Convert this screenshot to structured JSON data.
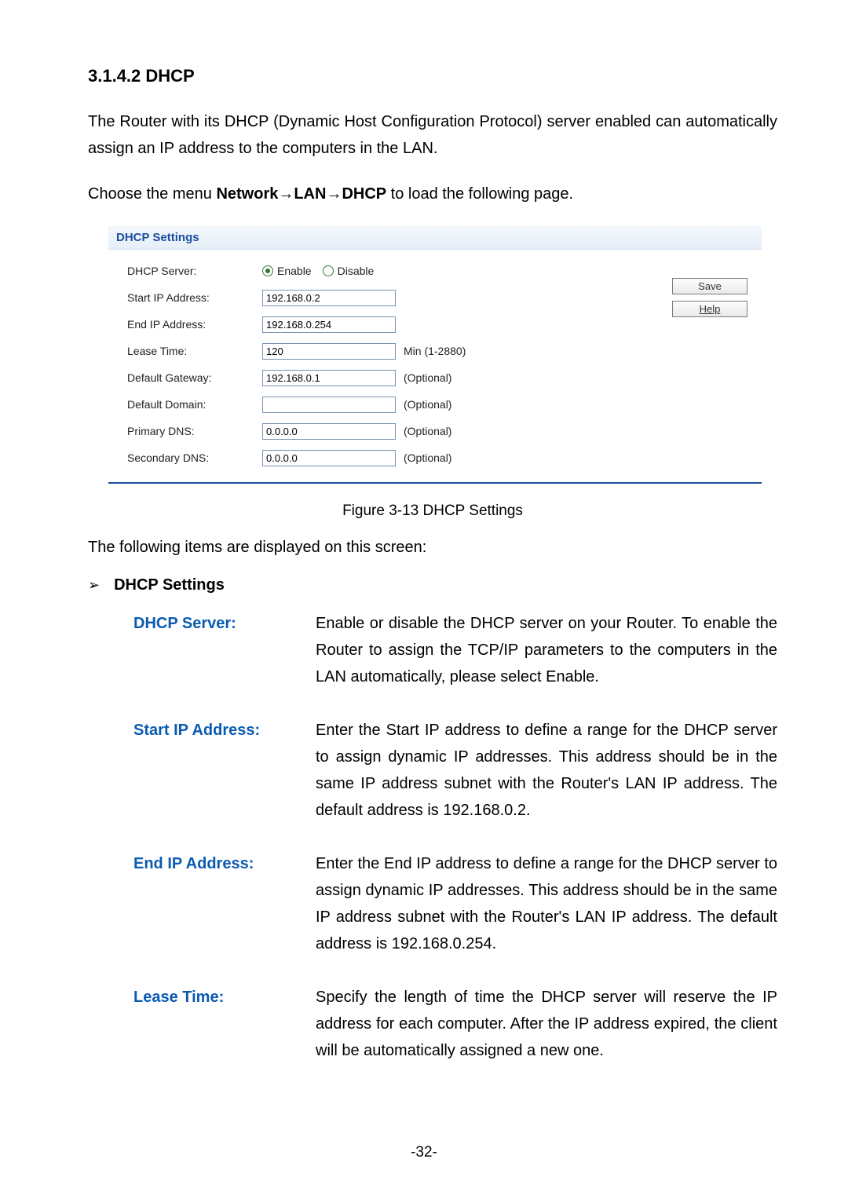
{
  "heading": "3.1.4.2    DHCP",
  "intro": "The Router with its DHCP (Dynamic Host Configuration Protocol) server enabled can automatically assign an IP address to the computers in the LAN.",
  "nav_text_1": "Choose the menu ",
  "nav_text_2": " to load the following page.",
  "nav_path": "Network→LAN→DHCP",
  "panel_title": "DHCP Settings",
  "form": {
    "dhcp_label": "DHCP Server:",
    "enable": "Enable",
    "disable": "Disable",
    "start_label": "Start IP Address:",
    "start_val": "192.168.0.2",
    "end_label": "End IP Address:",
    "end_val": "192.168.0.254",
    "lease_label": "Lease Time:",
    "lease_val": "120",
    "lease_note": "Min (1-2880)",
    "gateway_label": "Default Gateway:",
    "gateway_val": "192.168.0.1",
    "opt": "(Optional)",
    "domain_label": "Default Domain:",
    "domain_val": "",
    "pdns_label": "Primary DNS:",
    "pdns_val": "0.0.0.0",
    "sdns_label": "Secondary DNS:",
    "sdns_val": "0.0.0.0"
  },
  "buttons": {
    "save": "Save",
    "help": "Help"
  },
  "fig_cap": "Figure 3-13 DHCP Settings",
  "displayed": "The following items are displayed on this screen:",
  "bullet_glyph": "➢",
  "bullet_title": "DHCP Settings",
  "defs": {
    "dhcp_lbl": "DHCP Server:",
    "dhcp_txt": "Enable or disable the DHCP server on your Router. To enable the Router to assign the TCP/IP parameters to the computers in the LAN automatically, please select Enable.",
    "start_lbl": "Start IP Address:",
    "start_txt": "Enter the Start IP address to define a range for the DHCP server to assign dynamic IP addresses. This address should be in the same IP address subnet with the Router's LAN IP address. The default address is 192.168.0.2.",
    "end_lbl": "End IP Address:",
    "end_txt": "Enter the End IP address to define a range for the DHCP server to assign dynamic IP addresses. This address should be in the same IP address subnet with the Router's LAN IP address. The default address is 192.168.0.254.",
    "lease_lbl": "Lease Time:",
    "lease_txt": "Specify the length of time the DHCP server will reserve the IP address for each computer. After the IP address expired, the client will be automatically assigned a new one."
  },
  "page_no": "-32-"
}
